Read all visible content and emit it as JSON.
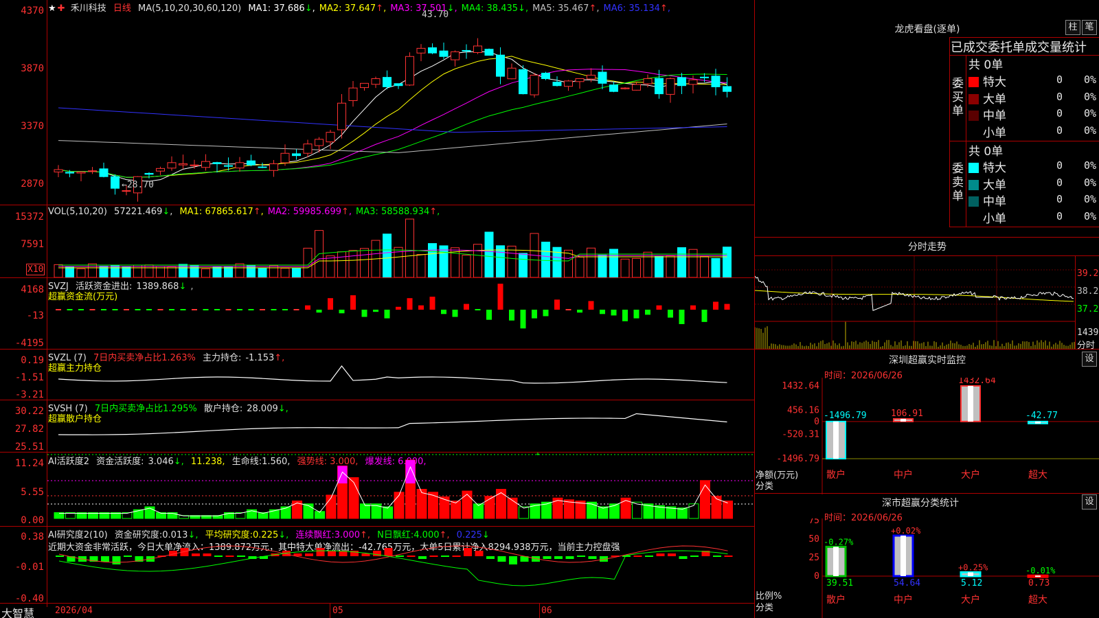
{
  "stock": {
    "name": "禾川科技",
    "period": "日线",
    "ma_title": "MA(5,10,20,30,60,120)",
    "ma": [
      {
        "label": "MA1:",
        "value": "37.686",
        "arrow": "↓",
        "color": "#ffffff"
      },
      {
        "label": "MA2:",
        "value": "37.647",
        "arrow": "↑",
        "color": "#ffff00"
      },
      {
        "label": "MA3:",
        "value": "37.501",
        "arrow": "↓",
        "color": "#ff00ff"
      },
      {
        "label": "MA4:",
        "value": "38.435",
        "arrow": "↓",
        "color": "#00ff00"
      },
      {
        "label": "MA5:",
        "value": "35.467",
        "arrow": "↑",
        "color": "#c0c0c0"
      },
      {
        "label": "MA6:",
        "value": "35.134",
        "arrow": "↑",
        "color": "#3232ff"
      }
    ],
    "high_mark": "43.70",
    "low_mark": "←28.70",
    "price_axis": [
      "4370",
      "3870",
      "3370",
      "2870"
    ]
  },
  "vol": {
    "title": "VOL(5,10,20)",
    "value": "57221.469",
    "arrow": "↓",
    "ma": [
      {
        "label": "MA1:",
        "value": "67865.617",
        "arrow": "↑",
        "color": "#ffff00"
      },
      {
        "label": "MA2:",
        "value": "59985.699",
        "arrow": "↑",
        "color": "#ff00ff"
      },
      {
        "label": "MA3:",
        "value": "58588.934",
        "arrow": "↑",
        "color": "#00ff00"
      }
    ],
    "axis": [
      "15372",
      "7591"
    ],
    "unit": "X10"
  },
  "svzj": {
    "title": "SVZJ",
    "label": "活跃资金进出:",
    "value": "1389.868",
    "arrow": "↓",
    "subtitle": "超赢资金流(万元)",
    "axis": [
      "4168",
      "-13",
      "-4195"
    ]
  },
  "svzl": {
    "title": "SVZL (7)",
    "note": "7日内买卖净占比1.263%",
    "label": "主力持仓:",
    "value": "-1.153",
    "arrow": "↑,",
    "subtitle": "超赢主力持仓",
    "axis": [
      "0.19",
      "-1.51",
      "-3.21"
    ]
  },
  "svsh": {
    "title": "SVSH (7)",
    "note": "7日内买卖净占比1.295%",
    "label": "散户持仓:",
    "value": "28.009",
    "arrow": "↓,",
    "subtitle": "超赢散户持仓",
    "axis": [
      "30.22",
      "27.82",
      "25.51"
    ]
  },
  "ai1": {
    "title": "AI活跃度2",
    "label": "资金活跃度:",
    "value": "3.046",
    "arrow": "↓,",
    "v2": "11.238,",
    "label3": "生命线:",
    "v3": "1.560,",
    "label4": "强势线: 3.000,",
    "label5": "爆发线: 6.000,",
    "axis": [
      "11.24",
      "5.55",
      "0.00"
    ]
  },
  "ai2": {
    "title": "AI研究度2(10)",
    "label": "资金研究度:",
    "value": "0.013",
    "arrow": "↓,",
    "label2": "平均研究度:",
    "v2": "0.225",
    "a2": "↓,",
    "label3": "连续飘红:",
    "v3": "3.000",
    "a3": "↑,",
    "label4": "N日飘红:",
    "v4": "4.000",
    "a4": "↑,",
    "v5": "0.225",
    "a5": "↓",
    "summary": "近期大资金非常活跃，今日大单净流入：1389.872万元，其中特大单净流出：-42.765万元，大单5日累计净入8294.938万元，当前主力控盘强",
    "axis": [
      "0.38",
      "-0.01",
      "-0.40"
    ]
  },
  "xaxis": {
    "brand": "大智慧",
    "dates": [
      "2026/04",
      "05",
      "06"
    ]
  },
  "right": {
    "dragon_title": "龙虎看盘(逐单)",
    "btn_zhu": "柱",
    "btn_bi": "笔",
    "order_title": "已成交委托单成交量统计",
    "buy_label": "委买单",
    "sell_label": "委卖单",
    "buy_total": "共 0单",
    "sell_total": "共 0单",
    "buy_rows": [
      {
        "name": "特大",
        "count": "0",
        "pct": "0%",
        "color": "#ff0000"
      },
      {
        "name": "大单",
        "count": "0",
        "pct": "0%",
        "color": "#8b0000"
      },
      {
        "name": "中单",
        "count": "0",
        "pct": "0%",
        "color": "#5a0000"
      },
      {
        "name": "小单",
        "count": "0",
        "pct": "0%",
        "color": ""
      }
    ],
    "sell_rows": [
      {
        "name": "特大",
        "count": "0",
        "pct": "0%",
        "color": "#00ffff"
      },
      {
        "name": "大单",
        "count": "0",
        "pct": "0%",
        "color": "#008b8b"
      },
      {
        "name": "中单",
        "count": "0",
        "pct": "0%",
        "color": "#006060"
      },
      {
        "name": "小单",
        "count": "0",
        "pct": "0%",
        "color": ""
      }
    ],
    "intraday_title": "分时走势",
    "intraday_axis": [
      "39.21",
      "38.25",
      "37.29"
    ],
    "intraday_vol": "1439",
    "intraday_vol_label": "分时",
    "sz_monitor_title": "深圳超赢实时监控",
    "btn_set": "设",
    "time_label": "时间：2026/06/26",
    "monitor_axis": [
      "1432.64",
      "456.16",
      "0",
      "-520.31",
      "-1496.79"
    ],
    "monitor_ylabel1": "净额(万元)",
    "monitor_ylabel2": "分类",
    "sz_class_title": "深市超赢分类统计",
    "class_axis": [
      "75",
      "50",
      "25",
      "0"
    ],
    "class_ylabel1": "比例%",
    "class_ylabel2": "分类",
    "categories": [
      "散户",
      "中户",
      "大户",
      "超大"
    ]
  },
  "chart_data": [
    {
      "type": "bar",
      "title": "深圳超赢实时监控",
      "categories": [
        "散户",
        "中户",
        "大户",
        "超大"
      ],
      "values": [
        -1496.79,
        106.91,
        1432.64,
        -42.77
      ],
      "labels": [
        "-1496.79",
        "106.91",
        "1432.64",
        "-42.77"
      ],
      "ylabel": "净额(万元)",
      "ylim": [
        -1496.79,
        1432.64
      ]
    },
    {
      "type": "bar",
      "title": "深市超赢分类统计",
      "categories": [
        "散户",
        "中户",
        "大户",
        "超大"
      ],
      "values": [
        39.51,
        54.64,
        5.12,
        0.73
      ],
      "changes": [
        "-0.27%",
        "+0.02%",
        "+0.25%",
        "-0.01%"
      ],
      "value_labels": [
        "39.51",
        "54.64",
        "5.12",
        "0.73"
      ],
      "ylabel": "比例%",
      "ylim": [
        0,
        75
      ]
    }
  ]
}
